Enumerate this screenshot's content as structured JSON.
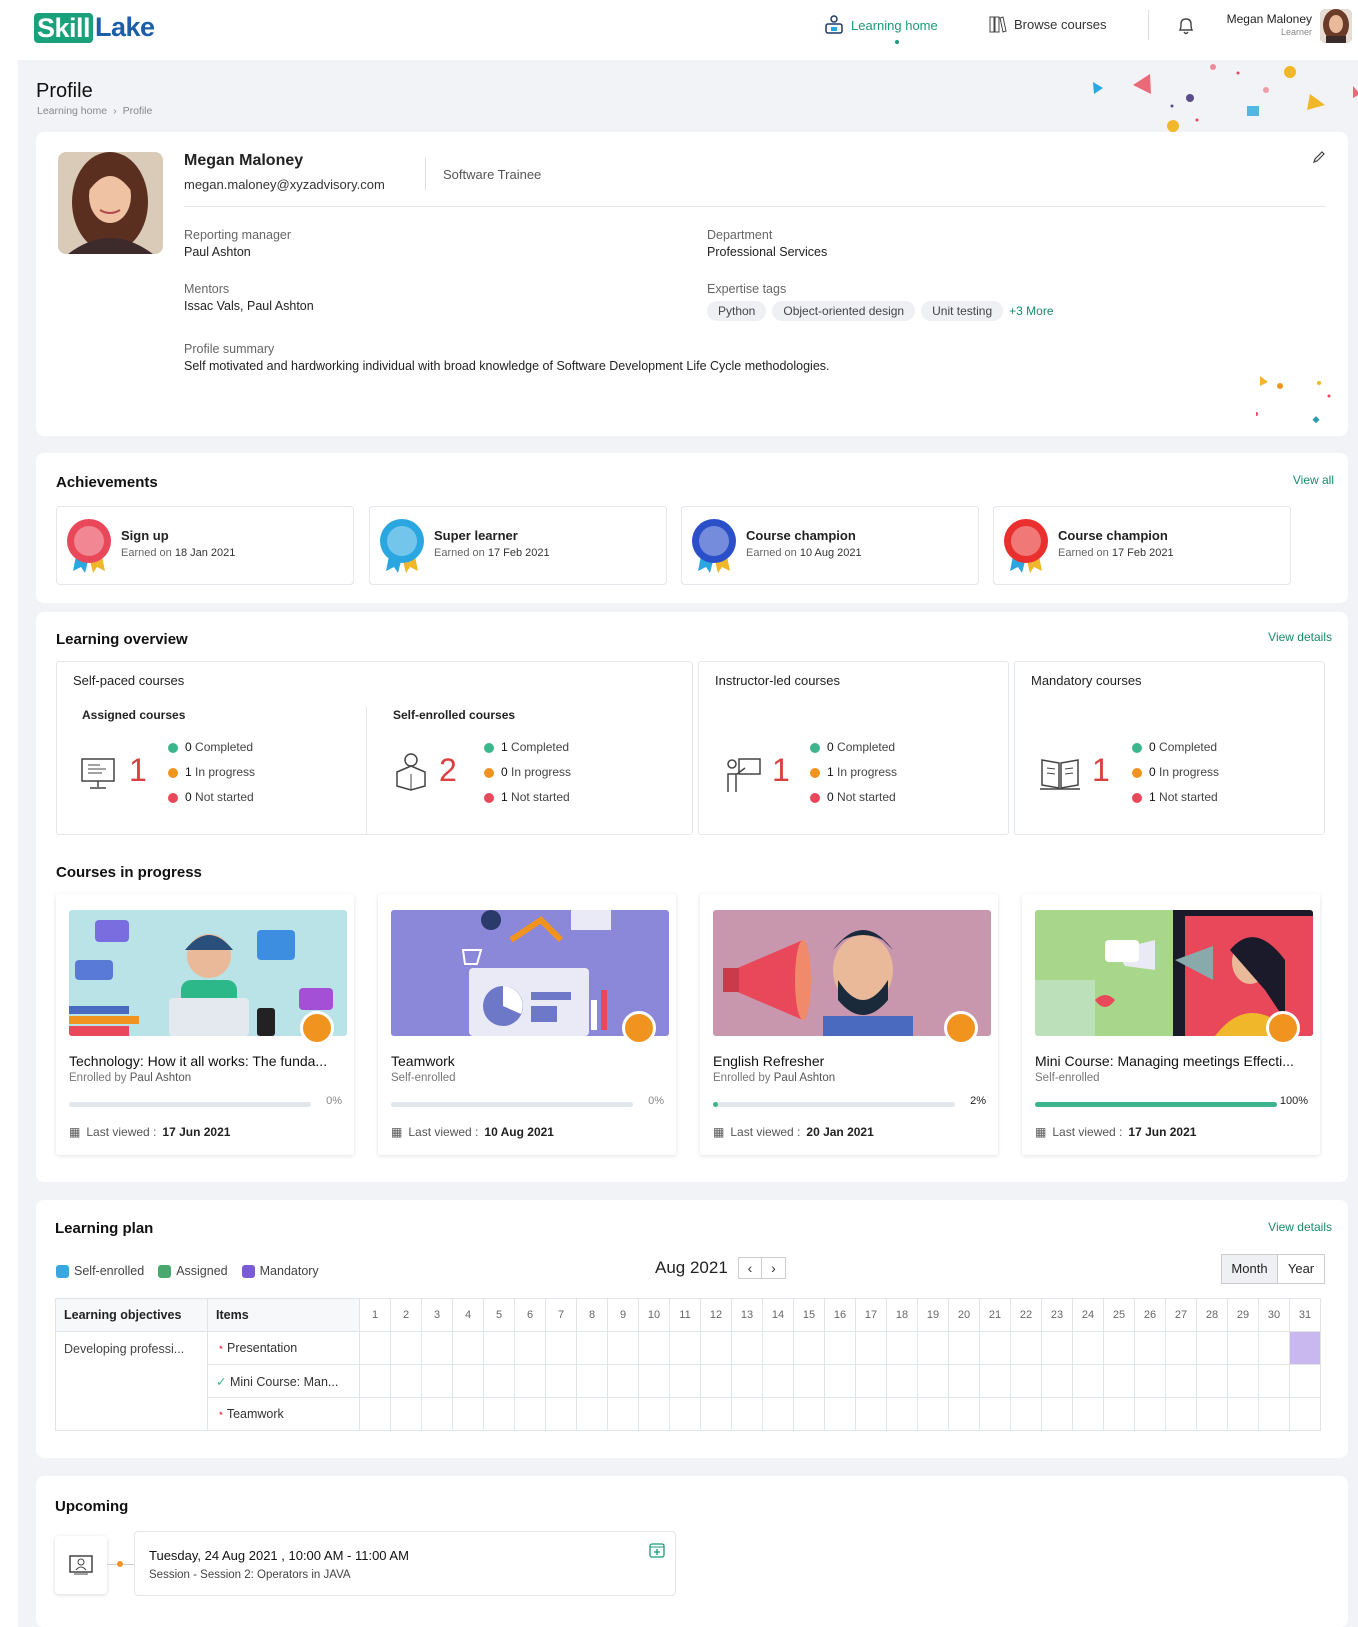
{
  "brand": {
    "part1": "Skill",
    "part2": "Lake"
  },
  "nav": {
    "learning_home": "Learning home",
    "browse_courses": "Browse courses"
  },
  "user": {
    "name": "Megan Maloney",
    "role": "Learner"
  },
  "page": {
    "title": "Profile",
    "breadcrumb_home": "Learning home",
    "breadcrumb_sep": "›",
    "breadcrumb_current": "Profile"
  },
  "profile": {
    "name": "Megan Maloney",
    "email": "megan.maloney@xyzadvisory.com",
    "job_title": "Software Trainee",
    "reporting_manager_label": "Reporting manager",
    "reporting_manager": "Paul Ashton",
    "department_label": "Department",
    "department": "Professional Services",
    "mentors_label": "Mentors",
    "mentors": "Issac Vals, Paul Ashton",
    "expertise_label": "Expertise tags",
    "tags": [
      "Python",
      "Object-oriented design",
      "Unit testing"
    ],
    "more_tags": "+3 More",
    "summary_label": "Profile summary",
    "summary": "Self motivated and hardworking individual with broad knowledge of Software Development Life Cycle methodologies."
  },
  "achievements": {
    "title": "Achievements",
    "view_all": "View all",
    "earned_prefix": "Earned on",
    "items": [
      {
        "name": "Sign up",
        "date": "18 Jan 2021",
        "icon": "hand-badge-icon",
        "color": "#e9475a"
      },
      {
        "name": "Super learner",
        "date": "17 Feb 2021",
        "icon": "check-badge-icon",
        "color": "#2aa7e0"
      },
      {
        "name": "Course champion",
        "date": "10 Aug 2021",
        "icon": "trophy-badge-icon",
        "color": "#2a4fc8"
      },
      {
        "name": "Course champion",
        "date": "17 Feb 2021",
        "icon": "trophy-badge-icon",
        "color": "#e9302f"
      }
    ]
  },
  "overview": {
    "title": "Learning overview",
    "view_details": "View details",
    "self_paced": "Self-paced courses",
    "assigned": {
      "label": "Assigned courses",
      "count": "1",
      "completed": "0",
      "in_progress": "1",
      "not_started": "0"
    },
    "self_enrolled": {
      "label": "Self-enrolled courses",
      "count": "2",
      "completed": "1",
      "in_progress": "0",
      "not_started": "1"
    },
    "instructor": {
      "label": "Instructor-led courses",
      "count": "1",
      "completed": "0",
      "in_progress": "1",
      "not_started": "0"
    },
    "mandatory": {
      "label": "Mandatory courses",
      "count": "1",
      "completed": "0",
      "in_progress": "0",
      "not_started": "1"
    },
    "completed_label": "Completed",
    "in_progress_label": "In progress",
    "not_started_label": "Not started"
  },
  "courses": {
    "title": "Courses in progress",
    "last_viewed_label": "Last viewed :",
    "items": [
      {
        "title": "Technology: How it all works: The funda...",
        "enroll_prefix": "Enrolled by",
        "enroll_name": "Paul Ashton",
        "progress": 0,
        "progress_label": "0%",
        "last_viewed": "17 Jun 2021"
      },
      {
        "title": "Teamwork",
        "enroll_prefix": "Self-enrolled",
        "enroll_name": "",
        "progress": 0,
        "progress_label": "0%",
        "last_viewed": "10 Aug 2021"
      },
      {
        "title": "English Refresher",
        "enroll_prefix": "Enrolled by",
        "enroll_name": "Paul Ashton",
        "progress": 2,
        "progress_label": "2%",
        "last_viewed": "20 Jan 2021"
      },
      {
        "title": "Mini Course: Managing meetings Effecti...",
        "enroll_prefix": "Self-enrolled",
        "enroll_name": "",
        "progress": 100,
        "progress_label": "100%",
        "last_viewed": "17 Jun 2021"
      }
    ]
  },
  "plan": {
    "title": "Learning plan",
    "view_details": "View details",
    "legend": [
      {
        "label": "Self-enrolled",
        "color": "#3aa6e0"
      },
      {
        "label": "Assigned",
        "color": "#48a86e"
      },
      {
        "label": "Mandatory",
        "color": "#7a5ad6"
      }
    ],
    "month": "Aug 2021",
    "prev": "‹",
    "next": "›",
    "view_month": "Month",
    "view_year": "Year",
    "col_objectives": "Learning objectives",
    "col_items": "Items",
    "objective": "Developing professi...",
    "items": [
      {
        "name": "Presentation",
        "status": "in-progress-icon"
      },
      {
        "name": "Mini Course: Man...",
        "status": "completed-icon"
      },
      {
        "name": "Teamwork",
        "status": "in-progress-icon"
      }
    ],
    "days": 31,
    "highlight_day": 31
  },
  "upcoming": {
    "title": "Upcoming",
    "datetime": "Tuesday, 24 Aug 2021 , 10:00 AM - 11:00 AM",
    "session_label": "Session",
    "session_name": "Session 2: Operators in JAVA"
  }
}
